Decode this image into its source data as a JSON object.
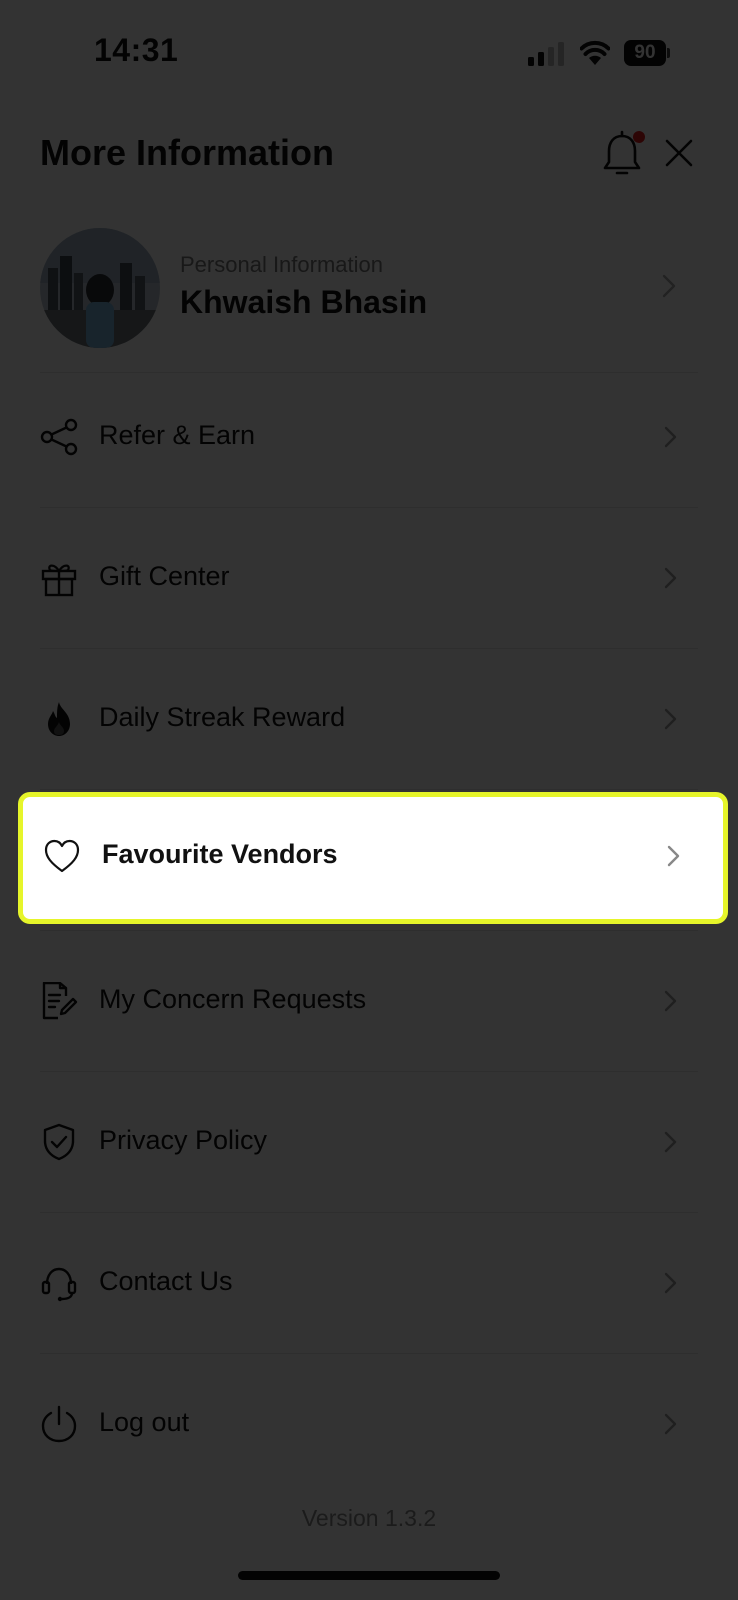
{
  "status_bar": {
    "time": "14:31",
    "battery": "90"
  },
  "header": {
    "title": "More Information"
  },
  "profile": {
    "caption": "Personal Information",
    "name": "Khwaish Bhasin"
  },
  "menu": [
    {
      "label": "Refer & Earn",
      "icon": "share-icon"
    },
    {
      "label": "Gift Center",
      "icon": "gift-icon"
    },
    {
      "label": "Daily Streak Reward",
      "icon": "flame-icon"
    },
    {
      "label": "Favourite Vendors",
      "icon": "heart-icon"
    },
    {
      "label": "My Concern Requests",
      "icon": "document-edit-icon"
    },
    {
      "label": "Privacy Policy",
      "icon": "shield-check-icon"
    },
    {
      "label": "Contact Us",
      "icon": "headset-icon"
    },
    {
      "label": "Log out",
      "icon": "power-icon"
    }
  ],
  "footer": {
    "version": "Version 1.3.2"
  },
  "colors": {
    "highlight_border": "#e6f52a",
    "notification_dot": "#e01b1b",
    "overlay": "rgba(0,0,0,0.8)"
  }
}
